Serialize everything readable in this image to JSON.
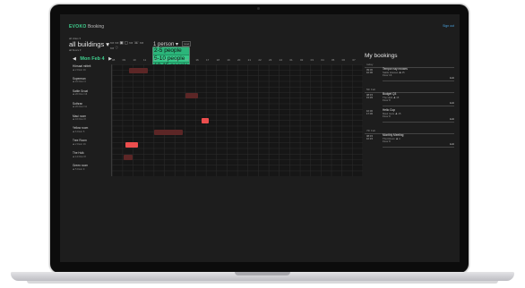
{
  "app": {
    "brand": "EVOKO",
    "product": "Booking",
    "signout": "Sign out"
  },
  "filters": {
    "area_label": "all cities ▾",
    "building": "all buildings ▾",
    "floor_label": "all floors ▾",
    "equipment_icons": [
      "▭",
      "▭",
      "▣",
      "▢",
      "▭",
      "☏",
      "▭",
      "▭",
      "♡"
    ],
    "people_selected": "1 person ▾",
    "reset": "reset",
    "people_options": [
      "2-5 people",
      "5-10 people",
      "10-15 people",
      "15-20 people",
      "20+ people"
    ],
    "people_highlighted": "5-10 people"
  },
  "date_nav": {
    "prev": "◀",
    "date": "Mon Feb 4",
    "next": "▶"
  },
  "hours": [
    "08",
    "09",
    "10",
    "11",
    "12",
    "13",
    "14",
    "15",
    "16",
    "17",
    "18",
    "19",
    "20",
    "21",
    "22",
    "23",
    "24",
    "01",
    "02",
    "03",
    "04",
    "05",
    "06",
    "07"
  ],
  "rooms": [
    {
      "name": "Hörsaal mitteit",
      "meta": "♟ 2  Floor 16"
    },
    {
      "name": "Superman",
      "meta": "♟ 10  Floor 3"
    },
    {
      "name": "Sattle Groat",
      "meta": "♟ 20  Floor 16"
    },
    {
      "name": "Sothran",
      "meta": "♟ 20  Floor 11"
    },
    {
      "name": "Maui room",
      "meta": "♟ 16  Floor 8"
    },
    {
      "name": "Yellow room",
      "meta": "♟ 6  Floor 5"
    },
    {
      "name": "Tree Room",
      "meta": "♟ 2  Floor 16"
    },
    {
      "name": "The Hulk",
      "meta": "♟ 14  Floor 8"
    },
    {
      "name": "Green room",
      "meta": "♟ 5  Floor 9"
    }
  ],
  "bookings": [
    {
      "room": 0,
      "start": 9.6,
      "end": 11.4,
      "style": "dim"
    },
    {
      "room": 2,
      "start": 15.0,
      "end": 16.2,
      "style": "dim"
    },
    {
      "room": 4,
      "start": 16.6,
      "end": 17.3,
      "style": "bright"
    },
    {
      "room": 5,
      "start": 12.0,
      "end": 14.8,
      "style": "dim"
    },
    {
      "room": 6,
      "start": 9.3,
      "end": 10.5,
      "style": "bright"
    },
    {
      "room": 7,
      "start": 9.1,
      "end": 10.0,
      "style": "dim"
    }
  ],
  "my_bookings": {
    "title": "My bookings",
    "groups": [
      {
        "day": "today",
        "items": [
          {
            "time": "09:30\n10:00",
            "name": "Tempor nay nnowrs",
            "room": "Sattle Houses  ♟ 25",
            "floor": "Floor 16",
            "edit": "Edit"
          }
        ]
      },
      {
        "day": "5th Feb",
        "items": [
          {
            "time": "08:15\n15:45",
            "name": "Budget Q3",
            "room": "The Hulk  ♟ 15",
            "floor": "Floor 8",
            "edit": "Edit"
          },
          {
            "time": "10:30\n17:30",
            "name": "Hello Cup",
            "room": "Maui room  ♟ 15",
            "floor": "Floor 8",
            "edit": "Edit"
          }
        ]
      },
      {
        "day": "7th Feb",
        "items": [
          {
            "time": "08:15\n10:15",
            "name": "Monthly Meeting",
            "room": "Thor Room  ♟ 4",
            "floor": "Floor 8",
            "edit": "Edit"
          }
        ]
      }
    ]
  },
  "colors": {
    "accent": "#3fcf8e",
    "booking_dim": "#5c2626",
    "booking_bright": "#ec4e4e"
  }
}
